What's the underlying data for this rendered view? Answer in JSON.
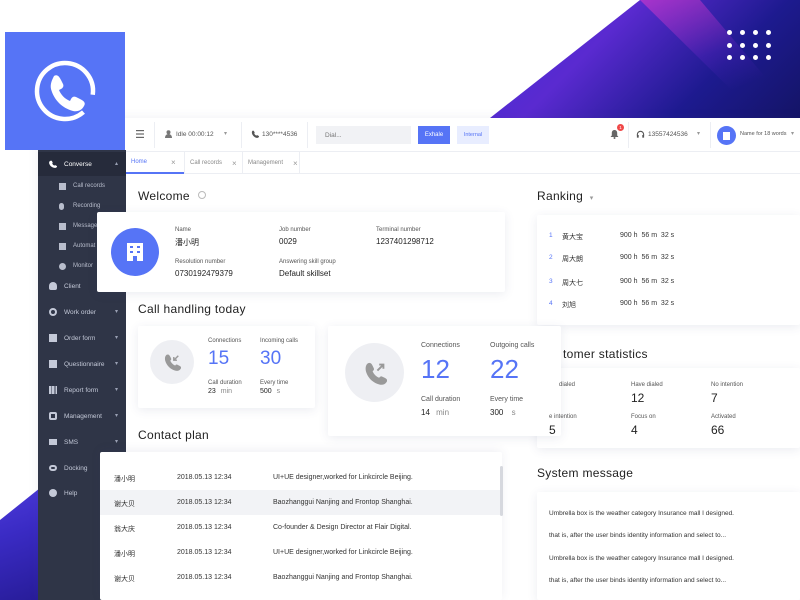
{
  "header": {
    "status": "Idle 00:00:12",
    "phone": "130****4536",
    "dial_placeholder": "Dial...",
    "exhale_label": "Exhale",
    "internal_label": "Internal",
    "notification_count": "1",
    "agent_phone": "13557424536",
    "user_name": "Name for 18 words"
  },
  "tabs": [
    {
      "label": "Home"
    },
    {
      "label": "Call records"
    },
    {
      "label": "Management"
    }
  ],
  "sidebar": {
    "items": [
      {
        "label": "Converse"
      },
      {
        "label": "Call records"
      },
      {
        "label": "Recording"
      },
      {
        "label": "Message"
      },
      {
        "label": "Automat"
      },
      {
        "label": "Monitor"
      },
      {
        "label": "Client"
      },
      {
        "label": "Work order"
      },
      {
        "label": "Order form"
      },
      {
        "label": "Questionnaire"
      },
      {
        "label": "Report form"
      },
      {
        "label": "Management"
      },
      {
        "label": "SMS"
      },
      {
        "label": "Docking"
      },
      {
        "label": "Help"
      }
    ]
  },
  "welcome": {
    "title": "Welcome",
    "name_label": "Name",
    "name_value": "潘小明",
    "job_label": "Job number",
    "job_value": "0029",
    "terminal_label": "Terminal number",
    "terminal_value": "1237401298712",
    "resolution_label": "Resolution number",
    "resolution_value": "0730192479379",
    "skill_label": "Answering skill group",
    "skill_value": "Default skillset"
  },
  "calls": {
    "title": "Call handling today",
    "incoming": {
      "connections_label": "Connections",
      "connections_value": "15",
      "calls_label": "Incoming calls",
      "calls_value": "30",
      "duration_label": "Call duration",
      "duration_value": "23",
      "duration_unit": "min",
      "every_label": "Every time",
      "every_value": "500",
      "every_unit": "s"
    },
    "outgoing": {
      "connections_label": "Connections",
      "connections_value": "12",
      "calls_label": "Outgoing calls",
      "calls_value": "22",
      "duration_label": "Call duration",
      "duration_value": "14",
      "duration_unit": "min",
      "every_label": "Every time",
      "every_value": "300",
      "every_unit": "s"
    }
  },
  "contact_plan": {
    "title": "Contact plan",
    "rows": [
      {
        "name": "潘小明",
        "time": "2018.05.13 12:34",
        "desc": "UI+UE designer,worked for Linkcircle Beijing."
      },
      {
        "name": "谢大贝",
        "time": "2018.05.13 12:34",
        "desc": "Baozhanggui Nanjing and Frontop Shanghai."
      },
      {
        "name": "翁大庆",
        "time": "2018.05.13 12:34",
        "desc": "Co-founder & Design Director at Flair Digital."
      },
      {
        "name": "潘小明",
        "time": "2018.05.13 12:34",
        "desc": "UI+UE designer,worked for Linkcircle Beijing."
      },
      {
        "name": "谢大贝",
        "time": "2018.05.13 12:34",
        "desc": "Baozhanggui Nanjing and Frontop Shanghai."
      }
    ]
  },
  "ranking": {
    "title": "Ranking",
    "items": [
      {
        "rank": "1",
        "name": "黄大宝",
        "h": "900",
        "m": "56",
        "s": "32"
      },
      {
        "rank": "2",
        "name": "周大朗",
        "h": "900",
        "m": "56",
        "s": "32"
      },
      {
        "rank": "3",
        "name": "周大七",
        "h": "900",
        "m": "56",
        "s": "32"
      },
      {
        "rank": "4",
        "name": "刘旭",
        "h": "900",
        "m": "56",
        "s": "32"
      }
    ],
    "unit_h": "h",
    "unit_m": "m",
    "unit_s": "s"
  },
  "customer": {
    "title": "tomer statistics",
    "cells": [
      {
        "label": "dialed",
        "value": ""
      },
      {
        "label": "Have dialed",
        "value": "12"
      },
      {
        "label": "No intention",
        "value": "7"
      },
      {
        "label": "e intention",
        "value": "5"
      },
      {
        "label": "Focus on",
        "value": "4"
      },
      {
        "label": "Activated",
        "value": "66"
      }
    ]
  },
  "system": {
    "title": "System message",
    "messages": [
      "Umbrella box is the weather category Insurance mall I designed.",
      "that is, after the user binds identity information and select to...",
      "Umbrella box is the weather category Insurance mall I designed.",
      "that is, after the user binds identity information and select to..."
    ]
  },
  "colors": {
    "accent": "#5674f6",
    "sidebar": "#2f3547"
  }
}
